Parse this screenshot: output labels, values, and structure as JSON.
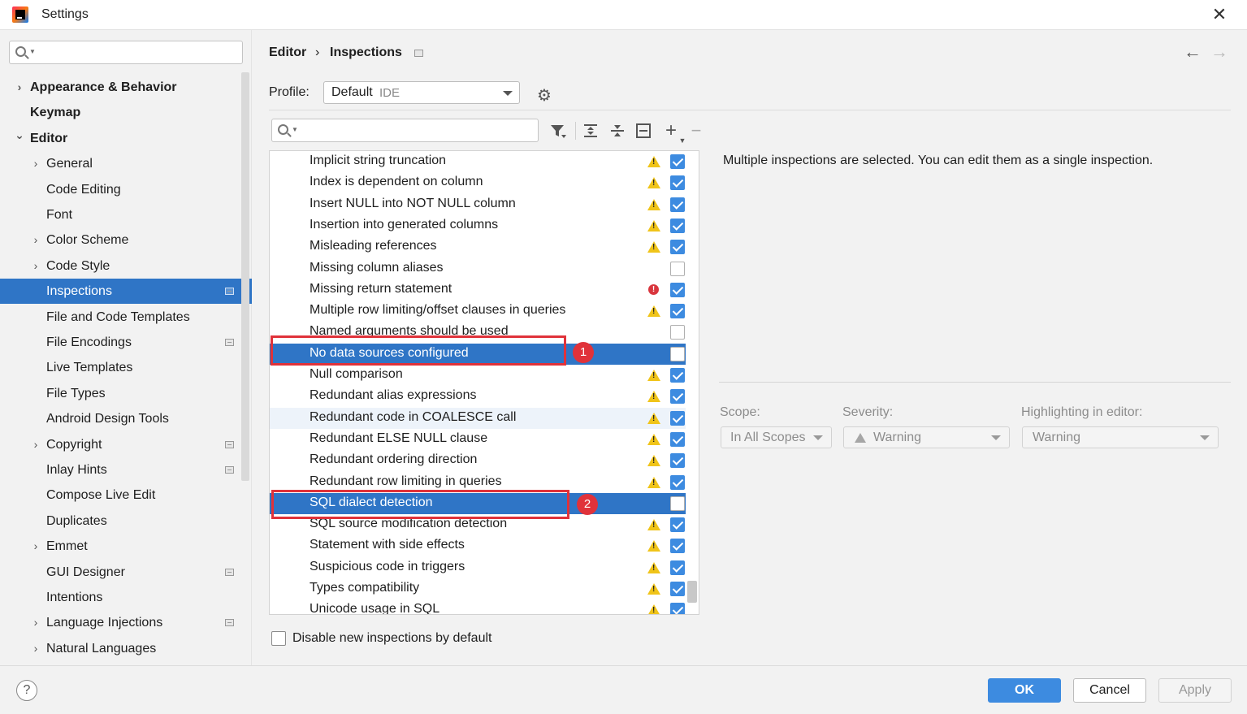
{
  "window": {
    "title": "Settings",
    "close_glyph": "✕"
  },
  "sidebar": {
    "search_placeholder": "",
    "items": [
      {
        "label": "Appearance & Behavior",
        "level": 0,
        "expandable": true,
        "expanded": false,
        "bold": true,
        "badge": false
      },
      {
        "label": "Keymap",
        "level": 0,
        "expandable": false,
        "bold": true,
        "badge": false
      },
      {
        "label": "Editor",
        "level": 0,
        "expandable": true,
        "expanded": true,
        "bold": true,
        "badge": false
      },
      {
        "label": "General",
        "level": 1,
        "expandable": true,
        "expanded": false,
        "badge": false
      },
      {
        "label": "Code Editing",
        "level": 1,
        "expandable": false,
        "badge": false
      },
      {
        "label": "Font",
        "level": 1,
        "expandable": false,
        "badge": false
      },
      {
        "label": "Color Scheme",
        "level": 1,
        "expandable": true,
        "expanded": false,
        "badge": false
      },
      {
        "label": "Code Style",
        "level": 1,
        "expandable": true,
        "expanded": false,
        "badge": false
      },
      {
        "label": "Inspections",
        "level": 1,
        "expandable": false,
        "badge": true,
        "selected": true
      },
      {
        "label": "File and Code Templates",
        "level": 1,
        "expandable": false,
        "badge": false
      },
      {
        "label": "File Encodings",
        "level": 1,
        "expandable": false,
        "badge": true
      },
      {
        "label": "Live Templates",
        "level": 1,
        "expandable": false,
        "badge": false
      },
      {
        "label": "File Types",
        "level": 1,
        "expandable": false,
        "badge": false
      },
      {
        "label": "Android Design Tools",
        "level": 1,
        "expandable": false,
        "badge": false
      },
      {
        "label": "Copyright",
        "level": 1,
        "expandable": true,
        "expanded": false,
        "badge": true
      },
      {
        "label": "Inlay Hints",
        "level": 1,
        "expandable": false,
        "badge": true
      },
      {
        "label": "Compose Live Edit",
        "level": 1,
        "expandable": false,
        "badge": false
      },
      {
        "label": "Duplicates",
        "level": 1,
        "expandable": false,
        "badge": false
      },
      {
        "label": "Emmet",
        "level": 1,
        "expandable": true,
        "expanded": false,
        "badge": false
      },
      {
        "label": "GUI Designer",
        "level": 1,
        "expandable": false,
        "badge": true
      },
      {
        "label": "Intentions",
        "level": 1,
        "expandable": false,
        "badge": false
      },
      {
        "label": "Language Injections",
        "level": 1,
        "expandable": true,
        "expanded": false,
        "badge": true
      },
      {
        "label": "Natural Languages",
        "level": 1,
        "expandable": true,
        "expanded": false,
        "badge": false
      }
    ]
  },
  "breadcrumb": {
    "first": "Editor",
    "separator": "›",
    "second": "Inspections"
  },
  "nav": {
    "back": "←",
    "forward": "→"
  },
  "profile": {
    "label": "Profile:",
    "value": "Default",
    "scope": "IDE"
  },
  "toolbar": {
    "filter_icon": "filter-icon",
    "expand_icon": "expand-all-icon",
    "collapse_icon": "collapse-all-icon",
    "reset_icon": "reset-icon",
    "add": "+",
    "remove": "−"
  },
  "inspections": [
    {
      "name": "Implicit string truncation",
      "severity": "warning",
      "checked": true
    },
    {
      "name": "Index is dependent on column",
      "severity": "warning",
      "checked": true
    },
    {
      "name": "Insert NULL into NOT NULL column",
      "severity": "warning",
      "checked": true
    },
    {
      "name": "Insertion into generated columns",
      "severity": "warning",
      "checked": true
    },
    {
      "name": "Misleading references",
      "severity": "warning",
      "checked": true
    },
    {
      "name": "Missing column aliases",
      "severity": "none",
      "checked": false
    },
    {
      "name": "Missing return statement",
      "severity": "error",
      "checked": true
    },
    {
      "name": "Multiple row limiting/offset clauses in queries",
      "severity": "warning",
      "checked": true
    },
    {
      "name": "Named arguments should be used",
      "severity": "none",
      "checked": false
    },
    {
      "name": "No data sources configured",
      "severity": "none",
      "checked": false,
      "selected": true
    },
    {
      "name": "Null comparison",
      "severity": "warning",
      "checked": true
    },
    {
      "name": "Redundant alias expressions",
      "severity": "warning",
      "checked": true
    },
    {
      "name": "Redundant code in COALESCE call",
      "severity": "warning",
      "checked": true,
      "hover": true
    },
    {
      "name": "Redundant ELSE NULL clause",
      "severity": "warning",
      "checked": true
    },
    {
      "name": "Redundant ordering direction",
      "severity": "warning",
      "checked": true
    },
    {
      "name": "Redundant row limiting in queries",
      "severity": "warning",
      "checked": true
    },
    {
      "name": "SQL dialect detection",
      "severity": "none",
      "checked": false,
      "selected": true
    },
    {
      "name": "SQL source modification detection",
      "severity": "warning",
      "checked": true
    },
    {
      "name": "Statement with side effects",
      "severity": "warning",
      "checked": true
    },
    {
      "name": "Suspicious code in triggers",
      "severity": "warning",
      "checked": true
    },
    {
      "name": "Types compatibility",
      "severity": "warning",
      "checked": true
    },
    {
      "name": "Unicode usage in SQL",
      "severity": "warning",
      "checked": true
    }
  ],
  "annotations": [
    "1",
    "2"
  ],
  "disable_new": {
    "label": "Disable new inspections by default",
    "checked": false
  },
  "description": "Multiple inspections are selected. You can edit them as a single inspection.",
  "options": {
    "scope_label": "Scope:",
    "scope_value": "In All Scopes",
    "severity_label": "Severity:",
    "severity_value": "Warning",
    "highlight_label": "Highlighting in editor:",
    "highlight_value": "Warning"
  },
  "footer": {
    "help": "?",
    "ok": "OK",
    "cancel": "Cancel",
    "apply": "Apply"
  },
  "colors": {
    "selection": "#2f75c6",
    "accent": "#3d8be0",
    "annotation": "#e0323a",
    "warning": "#f0c419",
    "error": "#d9363e"
  }
}
